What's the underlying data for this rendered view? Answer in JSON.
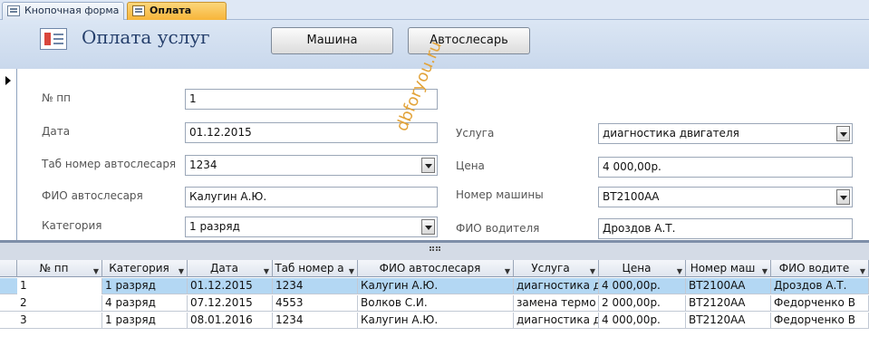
{
  "tabs": [
    {
      "label": "Кнопочная форма",
      "icon": "form-icon"
    },
    {
      "label": "Оплата услуг",
      "icon": "form-icon",
      "active": true
    }
  ],
  "header": {
    "title": "Оплата услуг",
    "buttons": [
      "Машина",
      "Автослесарь"
    ]
  },
  "form": {
    "left": [
      {
        "label": "№ пп",
        "value": "1"
      },
      {
        "label": "Дата",
        "value": "01.12.2015"
      },
      {
        "label": "Таб номер автослесаря",
        "value": "1234"
      },
      {
        "label": "ФИО автослесаря",
        "value": "Калугин А.Ю."
      },
      {
        "label": "Категория",
        "value": "1 разряд"
      }
    ],
    "right": [
      {
        "label": "Услуга",
        "value": "диагностика двигателя"
      },
      {
        "label": "Цена",
        "value": "4 000,00р."
      },
      {
        "label": "Номер машины",
        "value": "ВТ2100АА"
      },
      {
        "label": "ФИО водителя",
        "value": "Дроздов А.Т."
      }
    ]
  },
  "watermark": "dbforyou.ru",
  "grid": {
    "columns": [
      "№ пп",
      "Категория",
      "Дата",
      "Таб номер а",
      "ФИО автослесаря",
      "Услуга",
      "Цена",
      "Номер маш",
      "ФИО водите"
    ],
    "rows": [
      [
        "1",
        "1 разряд",
        "01.12.2015",
        "1234",
        "Калугин А.Ю.",
        "диагностика д",
        "4 000,00р.",
        "ВТ2100АА",
        "Дроздов А.Т."
      ],
      [
        "2",
        "4 разряд",
        "07.12.2015",
        "4553",
        "Волков С.И.",
        "замена термо",
        "2 000,00р.",
        "ВТ2120АА",
        "Федорченко В"
      ],
      [
        "3",
        "1 разряд",
        "08.01.2016",
        "1234",
        "Калугин А.Ю.",
        "диагностика д",
        "4 000,00р.",
        "ВТ2120АА",
        "Федорченко В"
      ]
    ]
  },
  "colors": {
    "accent_tab": "#f7b53a",
    "selected_row": "#b3d7f3",
    "header_bg": "#c9d8ec"
  }
}
